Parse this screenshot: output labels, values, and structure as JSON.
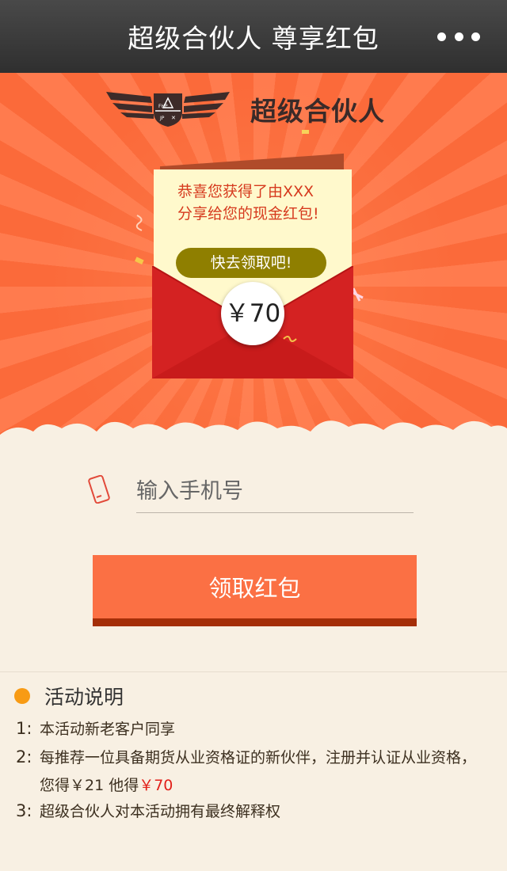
{
  "topbar": {
    "title": "超级合伙人  尊享红包",
    "more_icon": "more-dots-icon"
  },
  "hero": {
    "brand": "超级合伙人",
    "logo_icon": "winged-badge-logo-icon",
    "message_line1": "恭喜您获得了由XXX",
    "message_line2": "分享给您的现金红包!",
    "claim_pill": "快去领取吧!",
    "amount": "￥70"
  },
  "form": {
    "phone_placeholder": "输入手机号",
    "phone_icon": "phone-icon",
    "submit_label": "领取红包"
  },
  "rules": {
    "heading": "活动说明",
    "items": [
      {
        "num": "1:",
        "text": "本活动新老客户同享"
      },
      {
        "num": "2:",
        "text": "每推荐一位具备期货从业资格证的新伙伴，注册并认证从业资格，",
        "text2a": "您得￥21   他得",
        "text2b": "￥70"
      },
      {
        "num": "3:",
        "text": "超级合伙人对本活动拥有最终解释权"
      }
    ]
  },
  "colors": {
    "topbar": "#3b3b3b",
    "hero_orange": "#fb6a3a",
    "letter": "#fff9cc",
    "envelope_red": "#d42222",
    "pill": "#8f7f00",
    "button": "#fb7044",
    "button_shadow": "#a42e08",
    "bullet": "#f89b14",
    "background": "#f8f0e3",
    "highlight_red": "#e2201a"
  }
}
